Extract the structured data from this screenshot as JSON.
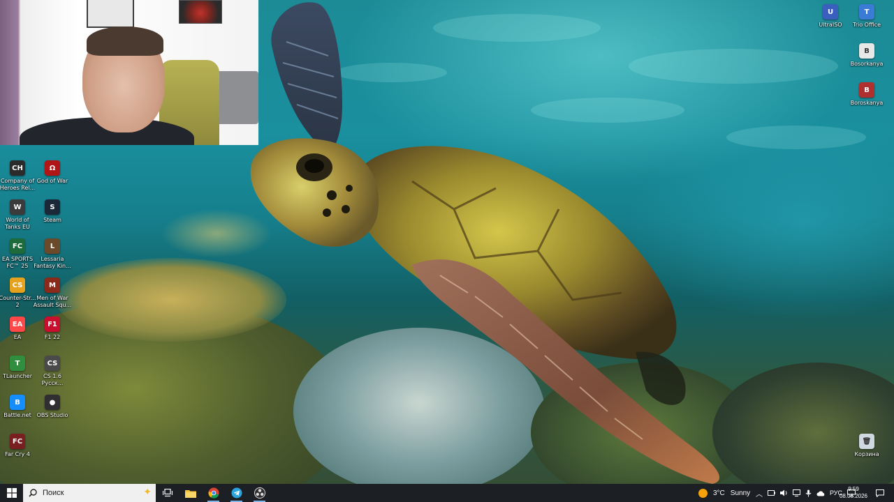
{
  "desktop": {
    "left_icons": [
      {
        "label": "Company of Heroes Rel...",
        "icon": "company-of-heroes-icon",
        "color": "#2b2b2b",
        "glyph": "CH"
      },
      {
        "label": "God of War",
        "icon": "god-of-war-icon",
        "color": "#b01616",
        "glyph": "Ω"
      },
      {
        "label": "World of Tanks EU",
        "icon": "world-of-tanks-icon",
        "color": "#3b3b3b",
        "glyph": "W"
      },
      {
        "label": "Steam",
        "icon": "steam-icon",
        "color": "#1b2838",
        "glyph": "S"
      },
      {
        "label": "EA SPORTS FC™ 25",
        "icon": "ea-sports-fc-icon",
        "color": "#1d6b3a",
        "glyph": "FC"
      },
      {
        "label": "Lessaria Fantasy Kin...",
        "icon": "lessaria-icon",
        "color": "#6a4a2a",
        "glyph": "L"
      },
      {
        "label": "Counter-Str... 2",
        "icon": "counter-strike-2-icon",
        "color": "#e7a21d",
        "glyph": "CS"
      },
      {
        "label": "Men of War Assault Squ...",
        "icon": "men-of-war-icon",
        "color": "#8a2a1a",
        "glyph": "M"
      },
      {
        "label": "EA",
        "icon": "ea-app-icon",
        "color": "#ff4747",
        "glyph": "EA"
      },
      {
        "label": "F1 22",
        "icon": "f1-22-icon",
        "color": "#c8102e",
        "glyph": "F1"
      },
      {
        "label": "TLauncher",
        "icon": "tlauncher-icon",
        "color": "#2f8f3e",
        "glyph": "T"
      },
      {
        "label": "CS 1.6 Русск...",
        "icon": "cs-16-icon",
        "color": "#4a4a4a",
        "glyph": "CS"
      },
      {
        "label": "Battle.net",
        "icon": "battle-net-icon",
        "color": "#148eff",
        "glyph": "B"
      },
      {
        "label": "OBS Studio",
        "icon": "obs-studio-icon",
        "color": "#302e31",
        "glyph": "●"
      },
      {
        "label": "Far Cry 4",
        "icon": "far-cry-4-icon",
        "color": "#7a1f1f",
        "glyph": "FC"
      }
    ],
    "right_icons": [
      {
        "label": "UltraISO",
        "icon": "ultraiso-icon",
        "color": "#3b5fbf",
        "glyph": "U"
      },
      {
        "label": "Trio Office",
        "icon": "trio-office-icon",
        "color": "#3a7bd5",
        "glyph": "T"
      },
      {
        "label": "Bosorkanya",
        "icon": "bosorkanya-icon",
        "color": "#e8e8e8",
        "glyph": "B"
      },
      {
        "label": "Boroskanya",
        "icon": "boroskanya-icon",
        "color": "#b03030",
        "glyph": "B"
      },
      {
        "label": "Корзина",
        "icon": "recycle-bin-icon",
        "color": "#cfd8e0",
        "glyph": "🗑"
      }
    ]
  },
  "taskbar": {
    "search_placeholder": "Поиск",
    "pinned": [
      {
        "name": "task-view-button",
        "icon": "task-view-icon"
      },
      {
        "name": "file-explorer-button",
        "icon": "folder-icon"
      },
      {
        "name": "chrome-button",
        "icon": "chrome-icon"
      },
      {
        "name": "telegram-button",
        "icon": "telegram-icon"
      },
      {
        "name": "obs-button",
        "icon": "obs-icon"
      }
    ],
    "weather": {
      "temp": "3°C",
      "condition": "Sunny"
    },
    "language": "РУС",
    "time": "9:59",
    "date": "08.03.2026"
  },
  "colors": {
    "taskbar_bg": "#1c1f24",
    "accent": "#7fb6ea"
  }
}
